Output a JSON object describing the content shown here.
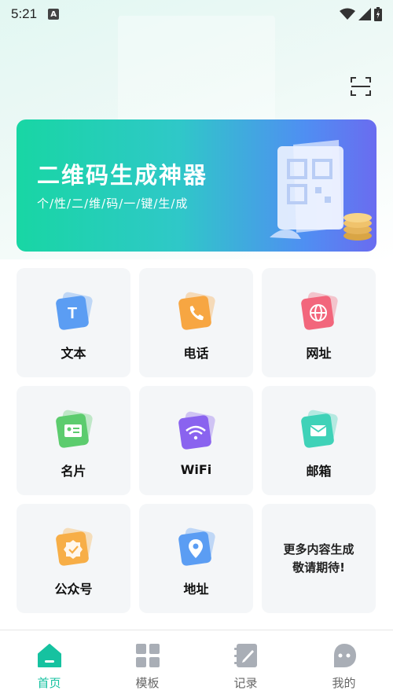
{
  "status": {
    "time": "5:21",
    "notification_letter": "A"
  },
  "banner": {
    "title": "二维码生成神器",
    "subtitle": "个/性/二/维/码/一/键/生/成"
  },
  "tiles": [
    {
      "label": "文本",
      "icon": "text-icon",
      "color": "#5b9df3",
      "glyph": "T"
    },
    {
      "label": "电话",
      "icon": "phone-icon",
      "color": "#f7a642",
      "glyph": "✆"
    },
    {
      "label": "网址",
      "icon": "globe-icon",
      "color": "#f2667c",
      "glyph": "⊕"
    },
    {
      "label": "名片",
      "icon": "id-card-icon",
      "color": "#5ccc6e",
      "glyph": "▤"
    },
    {
      "label": "WiFi",
      "icon": "wifi-icon",
      "color": "#8a63ef",
      "glyph": "◠"
    },
    {
      "label": "邮箱",
      "icon": "mail-icon",
      "color": "#3fd2b8",
      "glyph": "✉"
    },
    {
      "label": "公众号",
      "icon": "badge-icon",
      "color": "#f7ae47",
      "glyph": "✓"
    },
    {
      "label": "地址",
      "icon": "location-pin-icon",
      "color": "#5b9df3",
      "glyph": "●"
    }
  ],
  "more": {
    "line1": "更多内容生成",
    "line2": "敬请期待!"
  },
  "tabbar": [
    {
      "label": "首页",
      "icon": "home-icon",
      "active": true
    },
    {
      "label": "模板",
      "icon": "grid-icon",
      "active": false
    },
    {
      "label": "记录",
      "icon": "notebook-icon",
      "active": false
    },
    {
      "label": "我的",
      "icon": "profile-icon",
      "active": false
    }
  ],
  "colors": {
    "accent": "#16c2a0",
    "banner_start": "#18d6a4",
    "banner_end": "#6a6cf0",
    "tile_bg": "#f4f6f8"
  }
}
